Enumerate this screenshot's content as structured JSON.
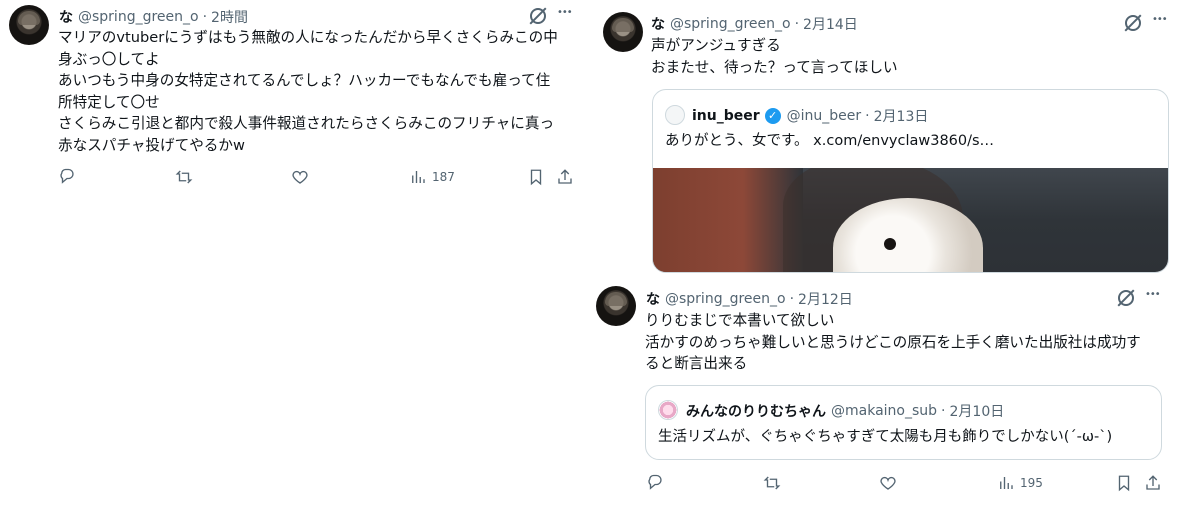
{
  "posts": [
    {
      "name": "な",
      "handle": "@spring_green_o",
      "time": "2時間",
      "lines": [
        "マリアのvtuberにうずはもう無敵の人になったんだから早くさくらみこの中",
        "身ぶっ〇してよ",
        "あいつもう中身の女特定されてるんでしょ？ハッカーでもなんでも雇って住",
        "所特定して〇せ",
        "さくらみこ引退と都内で殺人事件報道されたらさくらみこのフリチャに真っ",
        "赤なスパチャ投げてやるかw"
      ],
      "views": "187"
    },
    {
      "name": "な",
      "handle": "@spring_green_o",
      "time": "2月14日",
      "lines": [
        "声がアンジュすぎる",
        "おまたせ、待った？って言ってほしい"
      ],
      "quote": {
        "name": "inu_beer",
        "handle": "@inu_beer",
        "time": "2月13日",
        "text": "ありがとう、女です。  x.com/envyclaw3860/s…"
      }
    },
    {
      "name": "な",
      "handle": "@spring_green_o",
      "time": "2月12日",
      "lines": [
        "りりむまじで本書いて欲しい",
        "活かすのめっちゃ難しいと思うけどこの原石を上手く磨いた出版社は成功す",
        "ると断言出来る"
      ],
      "quote": {
        "name": "みんなのりりむちゃん",
        "handle": "@makaino_sub",
        "time": "2月10日",
        "text": "生活リズムが、ぐちゃぐちゃすぎて太陽も月も飾りでしかない(´-ω-`)"
      },
      "views": "195"
    }
  ],
  "ui": {
    "dot": "·",
    "more": "•••",
    "check": "✓"
  },
  "colors": {
    "accent": "#1d9bf0",
    "text": "#0f1419",
    "muted": "#536471",
    "border": "#cfd9de"
  },
  "icons": [
    "reply-icon",
    "repost-icon",
    "like-icon",
    "views-icon",
    "bookmark-icon",
    "share-icon",
    "grok-icon",
    "more-icon"
  ]
}
